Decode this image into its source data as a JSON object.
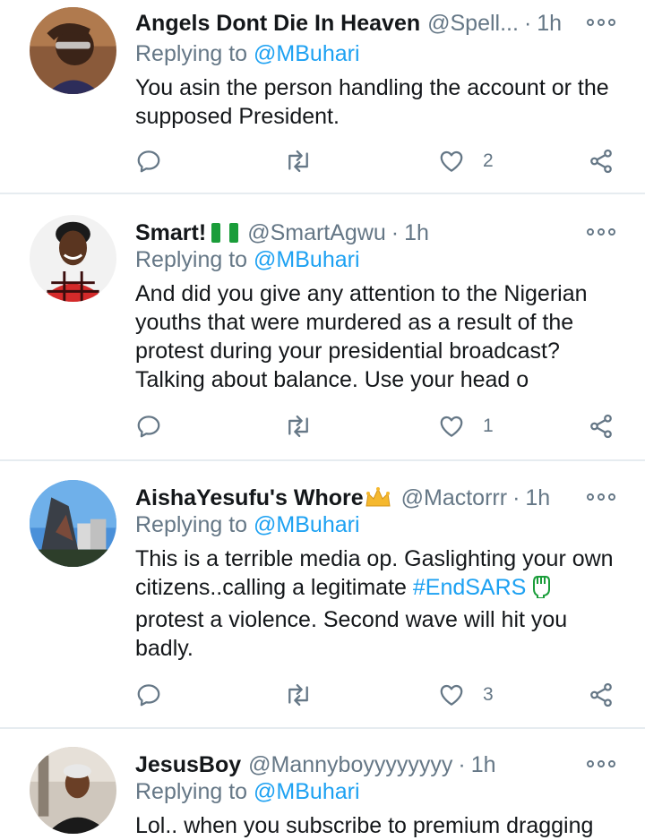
{
  "tweets": [
    {
      "name": "Angels Dont Die In Heaven",
      "handle": "@Spell...",
      "separator": "·",
      "time": "1h",
      "replying_prefix": "Replying to ",
      "replying_to": "@MBuhari",
      "text": "You asin the person handling the account or the supposed President.",
      "like_count": "2"
    },
    {
      "name": "Smart!",
      "handle": "@SmartAgwu",
      "separator": "·",
      "time": "1h",
      "replying_prefix": "Replying to ",
      "replying_to": "@MBuhari",
      "text": "And did you give any attention to the Nigerian youths that were murdered as a result of the protest during your presidential broadcast? Talking about balance. Use your head o",
      "like_count": "1",
      "badge_icon": "nigeria-flag-emoji"
    },
    {
      "name": "AishaYesufu's Whore",
      "handle": "@Mactorrr",
      "separator": "·",
      "time": "1h",
      "replying_prefix": "Replying to ",
      "replying_to": "@MBuhari",
      "text_before": "This is a terrible media op. Gaslighting your own citizens..calling a legitimate ",
      "hashtag": "#EndSARS",
      "text_after": " protest a violence. Second wave will hit you badly.",
      "like_count": "3",
      "badge_icon": "crown-emoji",
      "hashtag_icon": "raised-fist-emoji"
    },
    {
      "name": "JesusBoy",
      "handle": "@Mannyboyyyyyyyy",
      "separator": "·",
      "time": "1h",
      "replying_prefix": "Replying to ",
      "replying_to": "@MBuhari",
      "text": "Lol.. when you subscribe to premium dragging"
    }
  ],
  "colors": {
    "link": "#1da1f2",
    "secondary_text": "#657786",
    "primary_text": "#14171a",
    "divider": "#e6ecf0"
  }
}
